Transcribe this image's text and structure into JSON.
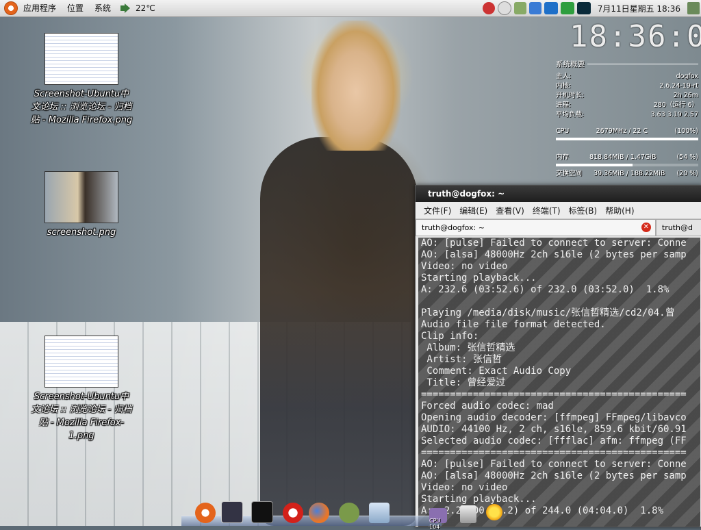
{
  "top_panel": {
    "menu": [
      "应用程序",
      "位置",
      "系统"
    ],
    "temperature": "22℃",
    "clock": "7月11日星期五 18:36"
  },
  "desktop_icons": [
    {
      "label": "Screenshot-Ubuntu中文论坛 :: 浏览论坛 - 归档贴 - Mozilla Firefox.png"
    },
    {
      "label": "screenshot.png"
    },
    {
      "label": "Screenshot-Ubuntu中文论坛 :: 浏览论坛 - 归档贴 - Mozilla Firefox-1.png"
    }
  ],
  "conky": {
    "clock": "18:36:01",
    "section_title": "系统概要",
    "rows": [
      {
        "label": "主人:",
        "value": "dogfox"
      },
      {
        "label": "内核:",
        "value": "2.6.24-19-rt"
      },
      {
        "label": "开机时长:",
        "value": "2h 26m"
      },
      {
        "label": "进程:",
        "value": "280（运行 6）"
      },
      {
        "label": "平均负载:",
        "value": "3.63 3.19 2.57"
      }
    ],
    "cpu": {
      "label": "CPU",
      "value": "2679MHz / 22 C",
      "percent": "(100%)",
      "fraction": 1.0
    },
    "mem": {
      "label": "内存",
      "value": "818.84MiB / 1.47GiB",
      "percent": "(54 %)",
      "fraction": 0.54
    },
    "swap": {
      "label": "交换空间",
      "value": "39.36MiB / 188.22MiB",
      "percent": "(20 %)",
      "fraction": 0.2
    }
  },
  "terminal": {
    "title": "truth@dogfox: ~",
    "menu": [
      "文件(F)",
      "编辑(E)",
      "查看(V)",
      "终端(T)",
      "标签(B)",
      "帮助(H)"
    ],
    "tabs": [
      "truth@dogfox: ~",
      "truth@d"
    ],
    "lines": [
      "AO: [pulse] Failed to connect to server: Conne",
      "AO: [alsa] 48000Hz 2ch s16le (2 bytes per samp",
      "Video: no video",
      "Starting playback...",
      "A: 232.6 (03:52.6) of 232.0 (03:52.0)  1.8%",
      "",
      "Playing /media/disk/music/张信哲精选/cd2/04.曾",
      "Audio file file format detected.",
      "Clip info:",
      " Album: 张信哲精选",
      " Artist: 张信哲",
      " Comment: Exact Audio Copy",
      " Title: 曾经爱过",
      "==============================================",
      "Forced audio codec: mad",
      "Opening audio decoder: [ffmpeg] FFmpeg/libavco",
      "AUDIO: 44100 Hz, 2 ch, s16le, 859.6 kbit/60.91",
      "Selected audio codec: [ffflac] afm: ffmpeg (FF",
      "==============================================",
      "AO: [pulse] Failed to connect to server: Conne",
      "AO: [alsa] 48000Hz 2ch s16le (2 bytes per samp",
      "Video: no video",
      "Starting playback...",
      "A:  2.2 (00:02.2) of 244.0 (04:04.0)  1.8%"
    ]
  },
  "dock": {
    "labels": [
      "CPU 104"
    ]
  }
}
